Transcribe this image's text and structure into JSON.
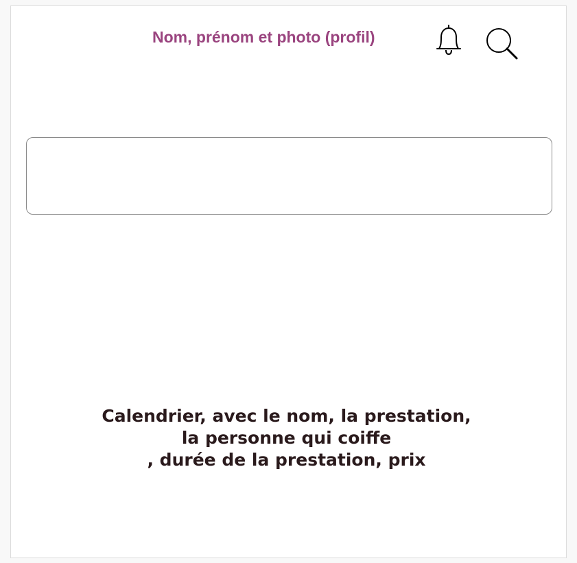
{
  "header": {
    "profile_label": "Nom, prénom et photo (profil)",
    "icons": {
      "notifications": "bell-icon",
      "search": "search-icon"
    },
    "accent_color": "#9a447f"
  },
  "search_box": {
    "value": "",
    "placeholder": ""
  },
  "calendar": {
    "line1": "Calendrier, avec le nom, la prestation,",
    "line2": "la personne qui coiffe",
    "line3": ", durée de la prestation, prix"
  }
}
